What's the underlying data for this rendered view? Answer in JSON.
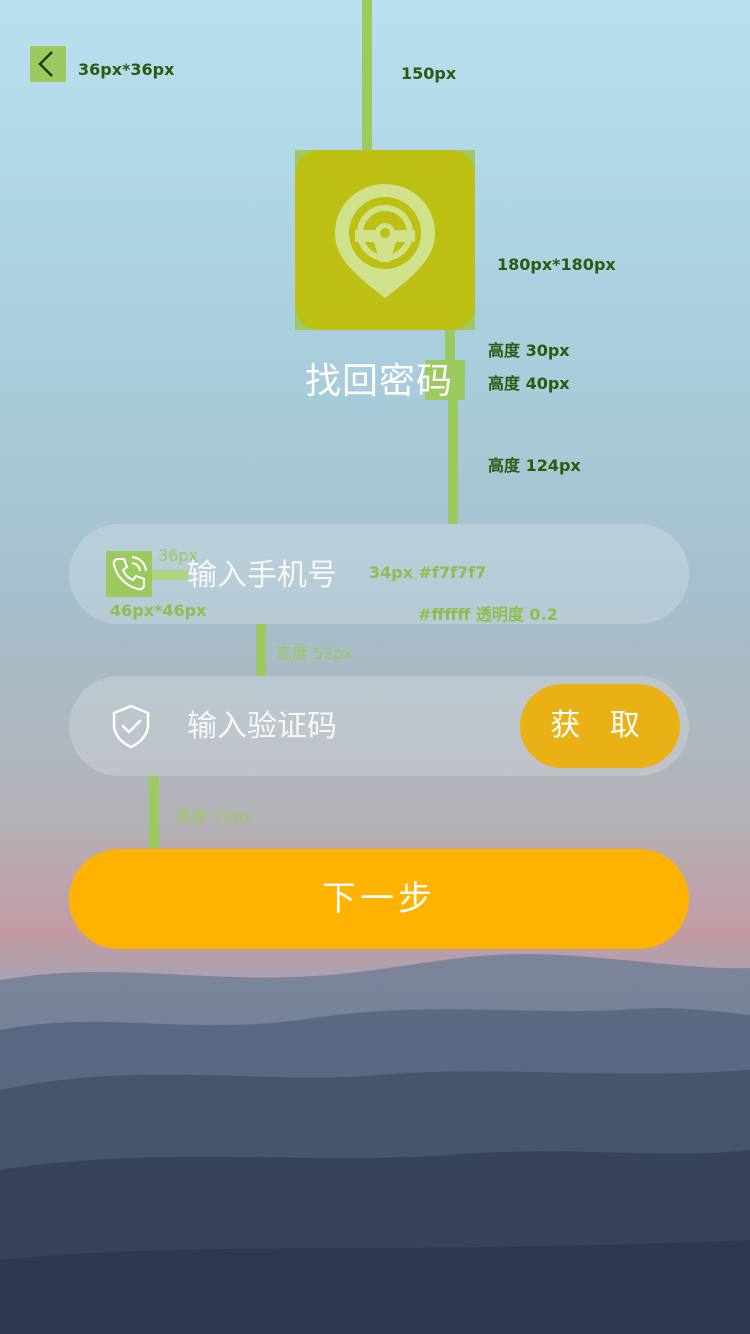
{
  "annotations": {
    "back_size": "36px*36px",
    "top_gap": "150px",
    "logo_size": "180px*180px",
    "h30": "高度 30px",
    "h40": "高度 40px",
    "h124": "高度 124px",
    "icon_gap": "36px",
    "text_spec": "34px #f7f7f7",
    "icon_size": "46px*46px",
    "pill_spec": "#ffffff 透明度 0.2",
    "h52": "高度 52px",
    "h72": "高度 72px"
  },
  "page": {
    "title": "找回密码"
  },
  "phone": {
    "placeholder": "输入手机号",
    "icon": "phone-icon"
  },
  "code": {
    "placeholder": "输入验证码",
    "icon": "shield-check-icon",
    "get_label": "获 取"
  },
  "next_label": "下一步",
  "colors": {
    "accent": "#ffb300",
    "get_button": "#e9b116",
    "logo": "#bdc012",
    "guide": "#9cca60"
  }
}
